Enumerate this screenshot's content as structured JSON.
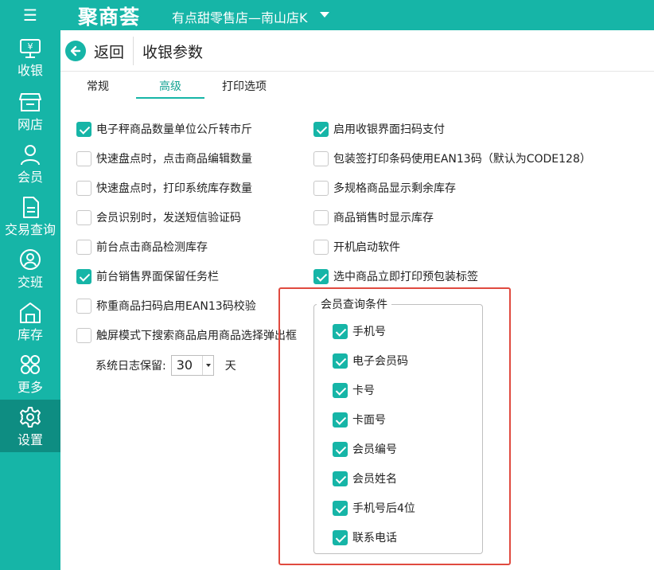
{
  "app": {
    "brand": "聚商荟",
    "store_name": "有点甜零售店—南山店K"
  },
  "nav": [
    {
      "label": "收银",
      "icon": "cashier-icon"
    },
    {
      "label": "网店",
      "icon": "shop-icon"
    },
    {
      "label": "会员",
      "icon": "member-icon"
    },
    {
      "label": "交易查询",
      "icon": "document-icon"
    },
    {
      "label": "交班",
      "icon": "handover-icon"
    },
    {
      "label": "库存",
      "icon": "warehouse-icon"
    },
    {
      "label": "更多",
      "icon": "more-icon"
    },
    {
      "label": "设置",
      "icon": "gear-icon",
      "active": true
    }
  ],
  "header": {
    "back_label": "返回",
    "title": "收银参数"
  },
  "tabs": [
    {
      "label": "常规",
      "active": false
    },
    {
      "label": "高级",
      "active": true
    },
    {
      "label": "打印选项",
      "active": false
    }
  ],
  "left_options": [
    {
      "label": "电子秤商品数量单位公斤转市斤",
      "checked": true
    },
    {
      "label": "快速盘点时，点击商品编辑数量",
      "checked": false
    },
    {
      "label": "快速盘点时，打印系统库存数量",
      "checked": false
    },
    {
      "label": "会员识别时，发送短信验证码",
      "checked": false
    },
    {
      "label": "前台点击商品检测库存",
      "checked": false
    },
    {
      "label": "前台销售界面保留任务栏",
      "checked": true
    },
    {
      "label": "称重商品扫码启用EAN13码校验",
      "checked": false
    },
    {
      "label": "触屏模式下搜索商品启用商品选择弹出框",
      "checked": false
    }
  ],
  "right_options": [
    {
      "label": "启用收银界面扫码支付",
      "checked": true
    },
    {
      "label": "包装签打印条码使用EAN13码（默认为CODE128）",
      "checked": false
    },
    {
      "label": "多规格商品显示剩余库存",
      "checked": false
    },
    {
      "label": "商品销售时显示库存",
      "checked": false
    },
    {
      "label": "开机启动软件",
      "checked": false
    },
    {
      "label": "选中商品立即打印预包装标签",
      "checked": true
    }
  ],
  "log_retention": {
    "label": "系统日志保留:",
    "value": "30",
    "unit": "天"
  },
  "member_query": {
    "title": "会员查询条件",
    "options": [
      {
        "label": "手机号",
        "checked": true
      },
      {
        "label": "电子会员码",
        "checked": true
      },
      {
        "label": "卡号",
        "checked": true
      },
      {
        "label": "卡面号",
        "checked": true
      },
      {
        "label": "会员编号",
        "checked": true
      },
      {
        "label": "会员姓名",
        "checked": true
      },
      {
        "label": "手机号后4位",
        "checked": true
      },
      {
        "label": "联系电话",
        "checked": true
      }
    ]
  },
  "colors": {
    "accent": "#16b5a7",
    "accent_dark": "#0e8d82",
    "highlight_border": "#e04a3f"
  }
}
